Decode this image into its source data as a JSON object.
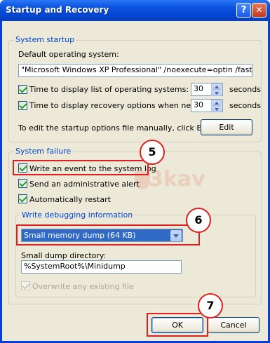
{
  "window": {
    "title": "Startup and Recovery",
    "help_glyph": "?",
    "close_glyph": "✕"
  },
  "system_startup": {
    "group_label": "System startup",
    "default_os_label": "Default operating system:",
    "default_os_value": "\"Microsoft Windows XP Professional\" /noexecute=optin /fastdete",
    "display_list_label": "Time to display list of operating systems:",
    "display_list_checked": true,
    "display_list_value": "30",
    "display_list_unit": "seconds",
    "recovery_label": "Time to display recovery options when needed:",
    "recovery_checked": true,
    "recovery_value": "30",
    "recovery_unit": "seconds",
    "edit_hint": "To edit the startup options file manually, click Edit.",
    "edit_button": "Edit"
  },
  "system_failure": {
    "group_label": "System failure",
    "write_event_label": "Write an event to the system log",
    "write_event_checked": true,
    "admin_alert_label": "Send an administrative alert",
    "admin_alert_checked": true,
    "auto_restart_label": "Automatically restart",
    "auto_restart_checked": true,
    "debug_info": {
      "group_label": "Write debugging information",
      "selected_option": "Small memory dump (64 KB)",
      "dump_dir_label": "Small dump directory:",
      "dump_dir_value": "%SystemRoot%\\Minidump",
      "overwrite_label": "Overwrite any existing file",
      "overwrite_checked": true,
      "overwrite_enabled": false
    }
  },
  "footer": {
    "ok_button": "OK",
    "cancel_button": "Cancel"
  },
  "annotations": {
    "callout_5": "5",
    "callout_6": "6",
    "callout_7": "7",
    "highlight_color": "#e02020"
  },
  "watermark": {
    "text": "3kav"
  },
  "colors": {
    "title_bar": "#0a53e0",
    "dialog_bg": "#ece9d8",
    "group_label": "#0046d5",
    "selection": "#316ac5"
  }
}
